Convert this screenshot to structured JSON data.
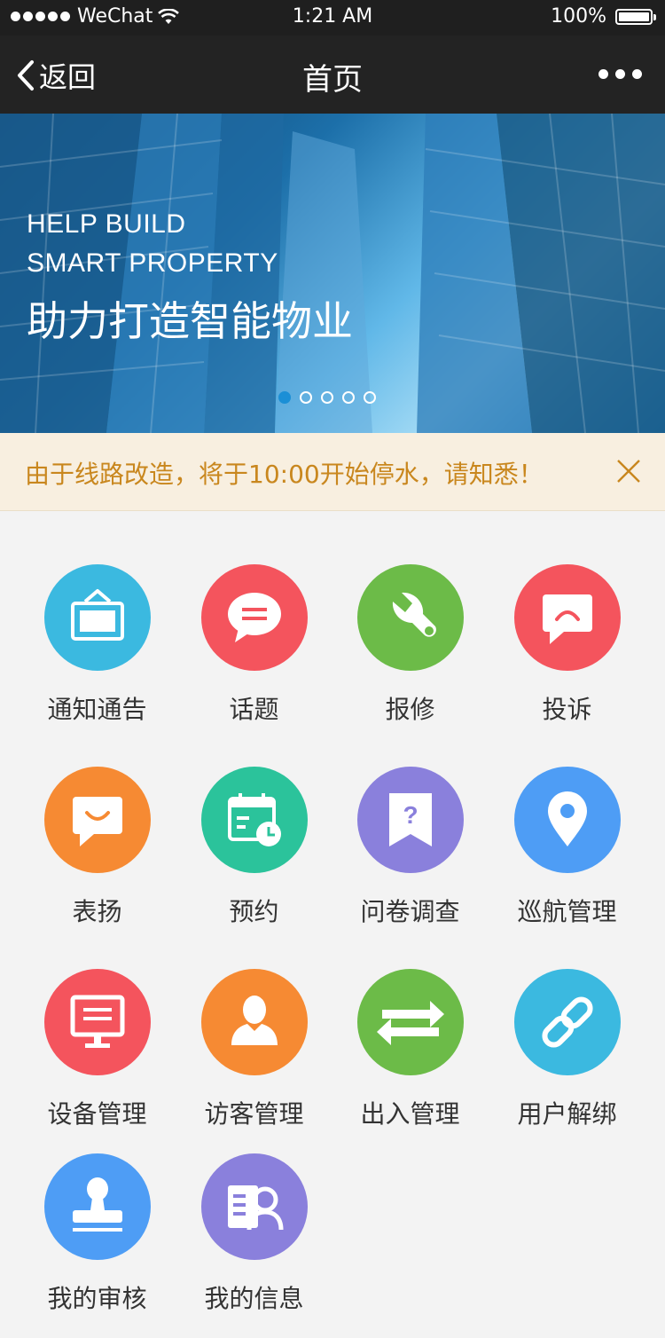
{
  "status_bar": {
    "carrier": "WeChat",
    "time": "1:21 AM",
    "battery": "100%"
  },
  "nav": {
    "back_label": "返回",
    "title": "首页"
  },
  "banner": {
    "line1": "HELP BUILD",
    "line2": "SMART PROPERTY",
    "line3": "助力打造智能物业",
    "pages": 5,
    "active_page": 1
  },
  "notice": {
    "text": "由于线路改造，将于10:00开始停水，请知悉！"
  },
  "grid": [
    {
      "label": "通知通告",
      "color": "#3bb9e0",
      "icon": "notice-board-icon"
    },
    {
      "label": "话题",
      "color": "#f4545d",
      "icon": "chat-bubble-icon"
    },
    {
      "label": "报修",
      "color": "#6cbb48",
      "icon": "wrench-icon"
    },
    {
      "label": "投诉",
      "color": "#f4545d",
      "icon": "complaint-bubble-icon"
    },
    {
      "label": "表扬",
      "color": "#f68a33",
      "icon": "smile-bubble-icon"
    },
    {
      "label": "预约",
      "color": "#2bc39b",
      "icon": "calendar-clock-icon"
    },
    {
      "label": "问卷调查",
      "color": "#8a80dc",
      "icon": "question-bookmark-icon"
    },
    {
      "label": "巡航管理",
      "color": "#4e9df5",
      "icon": "location-pin-icon"
    },
    {
      "label": "设备管理",
      "color": "#f4545d",
      "icon": "monitor-icon"
    },
    {
      "label": "访客管理",
      "color": "#f68a33",
      "icon": "visitor-person-icon"
    },
    {
      "label": "出入管理",
      "color": "#6cbb48",
      "icon": "swap-arrows-icon"
    },
    {
      "label": "用户解绑",
      "color": "#3bb9e0",
      "icon": "link-icon"
    },
    {
      "label": "我的审核",
      "color": "#4e9df5",
      "icon": "stamp-icon"
    },
    {
      "label": "我的信息",
      "color": "#8a80dc",
      "icon": "profile-card-icon"
    }
  ]
}
